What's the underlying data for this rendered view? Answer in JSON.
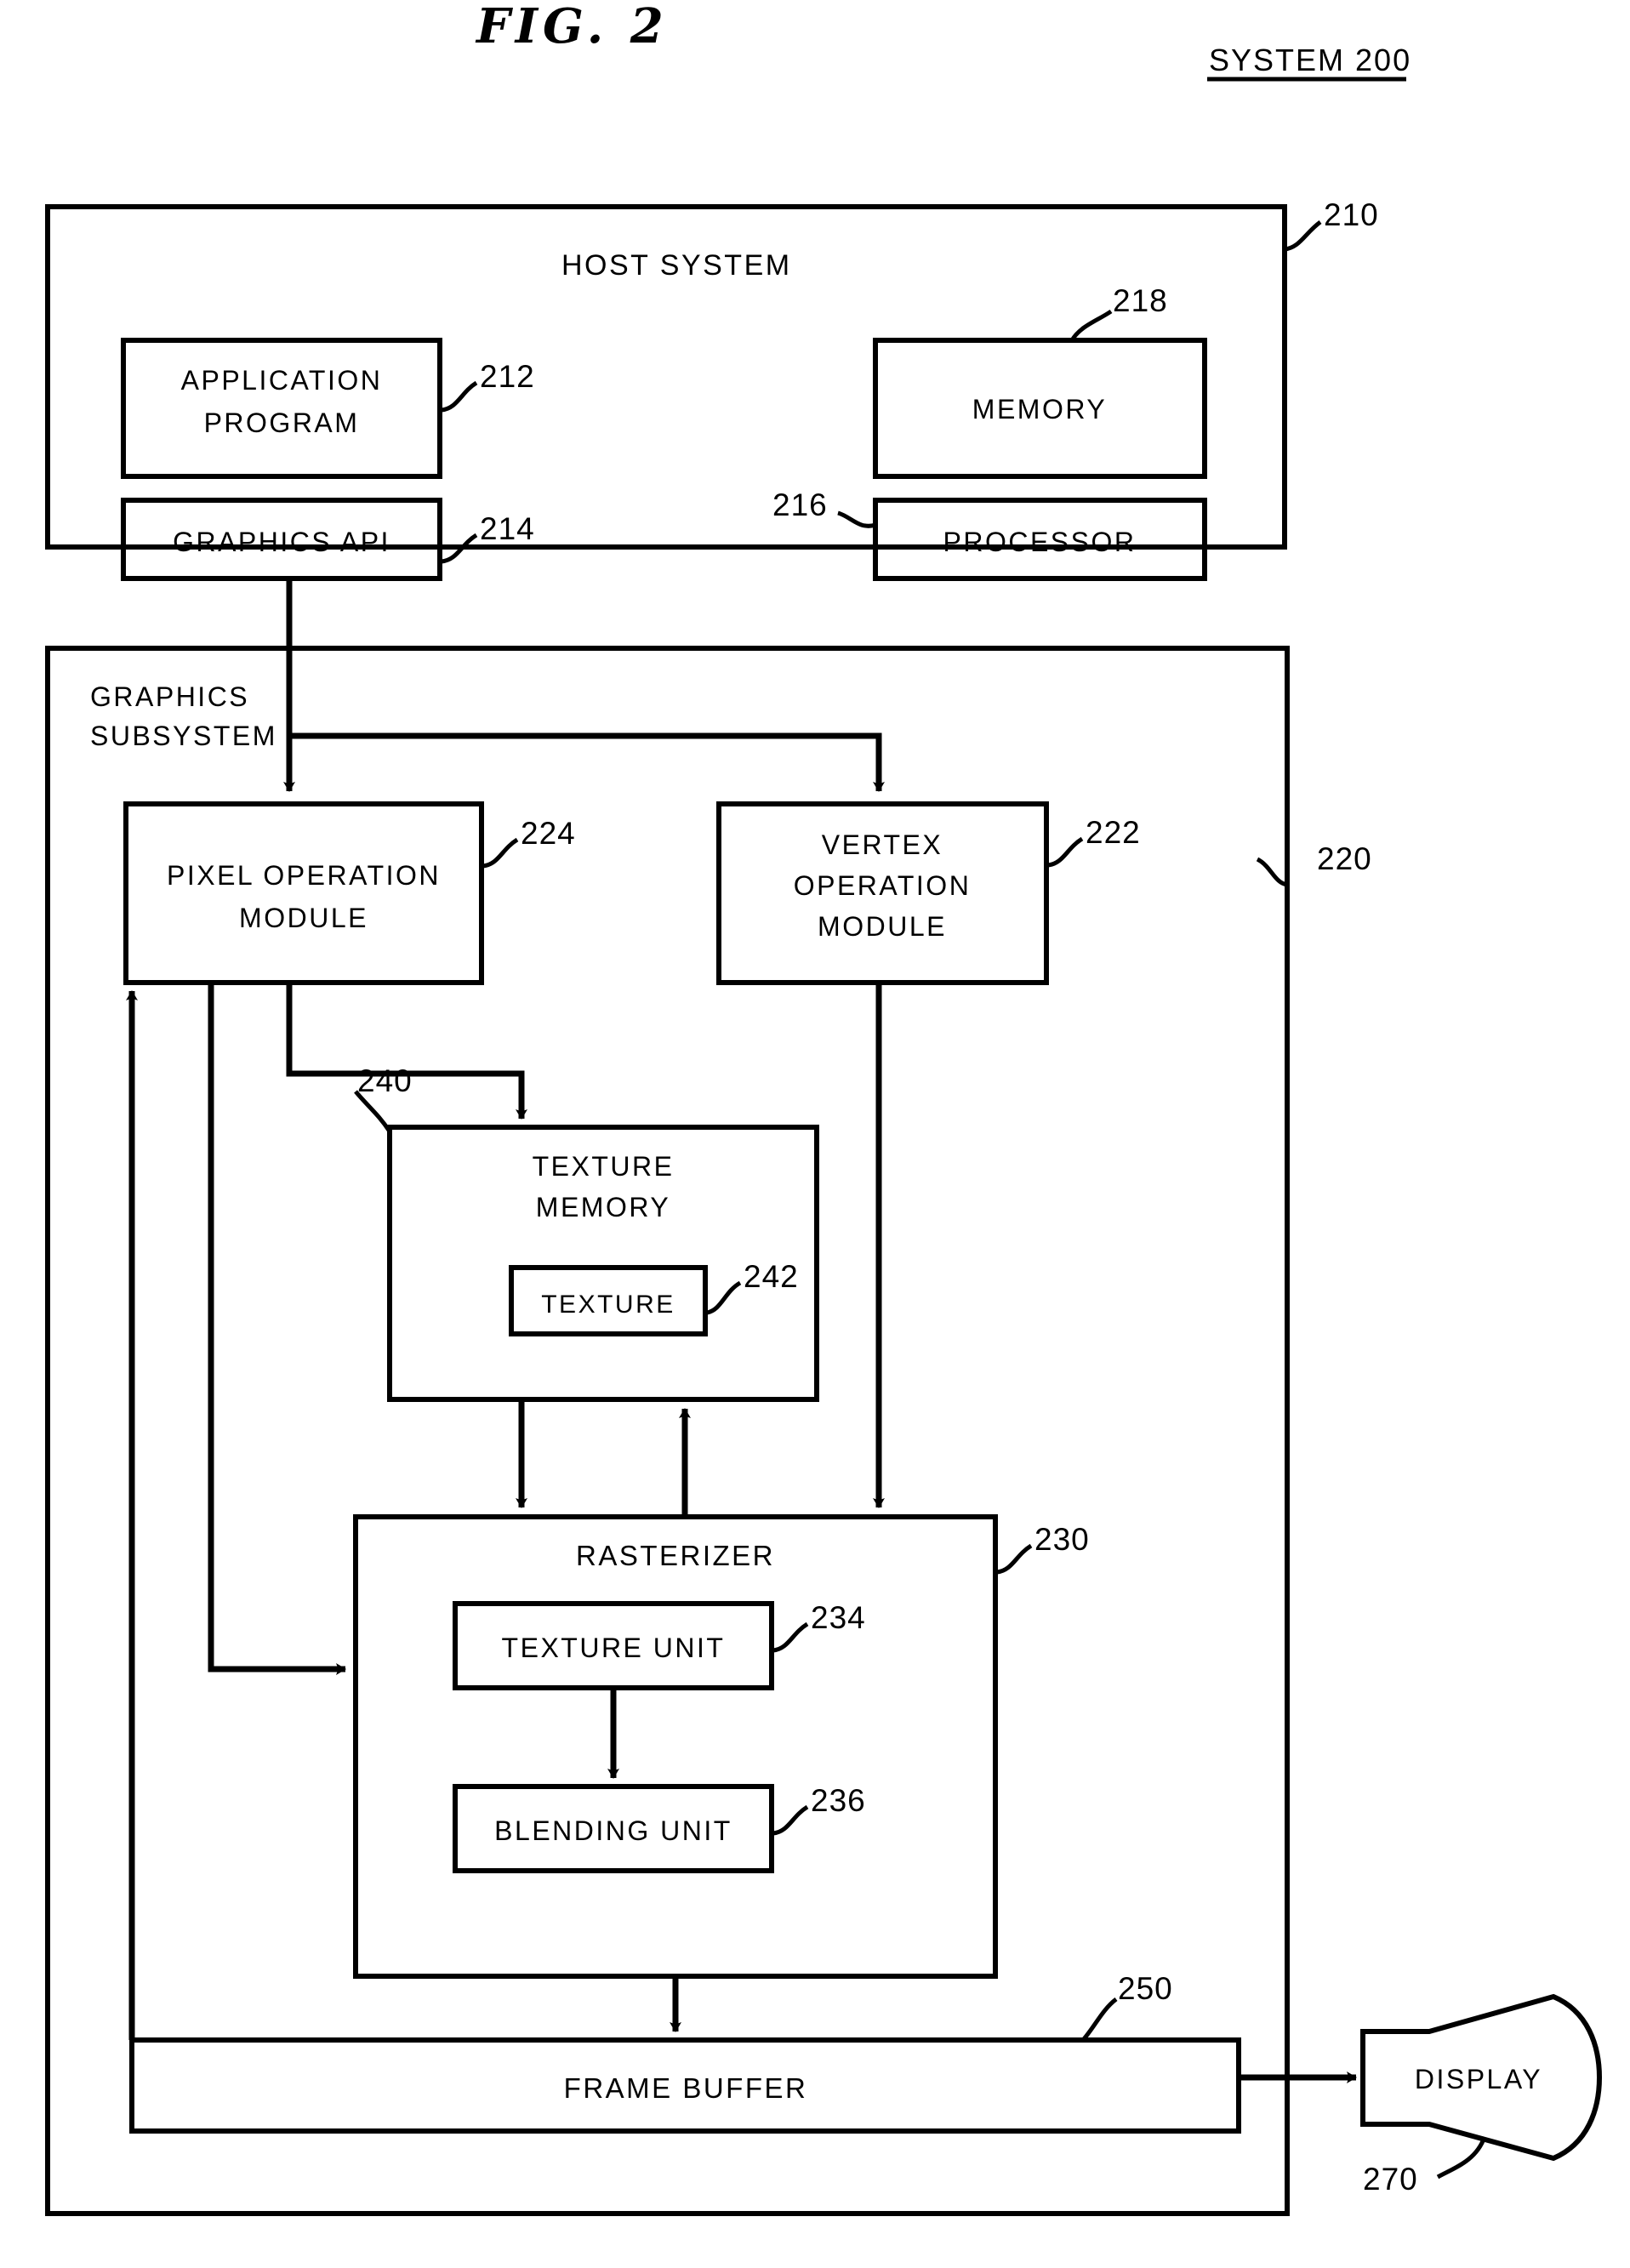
{
  "figure": {
    "title": "FIG. 2",
    "system_label": "SYSTEM 200",
    "domain": "patent-block-diagram"
  },
  "blocks": {
    "host_system": {
      "label": "HOST SYSTEM",
      "ref": "210"
    },
    "application_program": {
      "label_line1": "APPLICATION",
      "label_line2": "PROGRAM",
      "ref": "212"
    },
    "graphics_api": {
      "label": "GRAPHICS API",
      "ref": "214"
    },
    "memory": {
      "label": "MEMORY",
      "ref": "218"
    },
    "processor": {
      "label": "PROCESSOR",
      "ref": "216"
    },
    "graphics_subsystem": {
      "label_line1": "GRAPHICS",
      "label_line2": "SUBSYSTEM",
      "ref": "220"
    },
    "pixel_operation_module": {
      "label_line1": "PIXEL OPERATION",
      "label_line2": "MODULE",
      "ref": "224"
    },
    "vertex_operation_module": {
      "label_line1": "VERTEX",
      "label_line2": "OPERATION",
      "label_line3": "MODULE",
      "ref": "222"
    },
    "texture_memory": {
      "label_line1": "TEXTURE",
      "label_line2": "MEMORY",
      "ref": "240"
    },
    "texture": {
      "label": "TEXTURE",
      "ref": "242"
    },
    "rasterizer": {
      "label": "RASTERIZER",
      "ref": "230"
    },
    "texture_unit": {
      "label": "TEXTURE UNIT",
      "ref": "234"
    },
    "blending_unit": {
      "label": "BLENDING UNIT",
      "ref": "236"
    },
    "frame_buffer": {
      "label": "FRAME BUFFER",
      "ref": "250"
    },
    "display": {
      "label": "DISPLAY",
      "ref": "270"
    }
  },
  "colors": {
    "ink": "#000000",
    "paper": "#ffffff"
  }
}
